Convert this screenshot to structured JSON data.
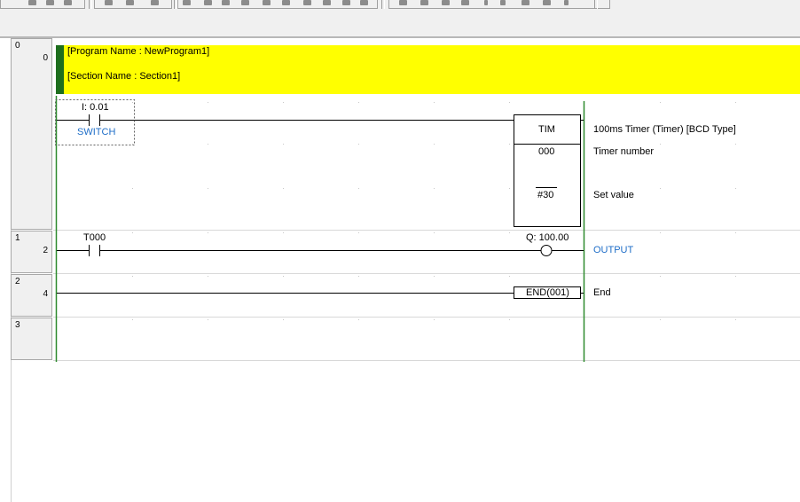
{
  "toolbar": {
    "icons": [
      "cut-icon",
      "copy-icon",
      "paste-icon",
      "undo-icon",
      "redo-icon",
      "find-icon",
      "zoom-icon",
      "contact-icon",
      "coil-icon",
      "instruction-icon",
      "line-icon"
    ]
  },
  "rungs": [
    {
      "rung_number": "0",
      "step": "0",
      "comment": {
        "program_name": "[Program Name : NewProgram1]",
        "section_name": "[Section Name : Section1]"
      },
      "contact": {
        "address": "I: 0.01",
        "symbol": "SWITCH"
      },
      "instruction": {
        "mnemonic": "TIM",
        "operand1": "000",
        "operand2": "#30",
        "desc": "100ms Timer (Timer) [BCD Type]",
        "operand1_desc": "Timer number",
        "operand2_desc": "Set value"
      }
    },
    {
      "rung_number": "1",
      "step": "2",
      "contact": {
        "address": "T000"
      },
      "coil": {
        "address": "Q: 100.00",
        "symbol": "OUTPUT"
      }
    },
    {
      "rung_number": "2",
      "step": "4",
      "instruction": {
        "mnemonic": "END(001)",
        "desc": "End"
      }
    },
    {
      "rung_number": "3"
    }
  ],
  "colors": {
    "comment_bg": "#ffff00",
    "comment_marker": "#1e6e1e",
    "rail": "#2e8b2e",
    "symbol_text": "#1f6ec8",
    "rung_cell_bg": "#f0f0f0"
  }
}
